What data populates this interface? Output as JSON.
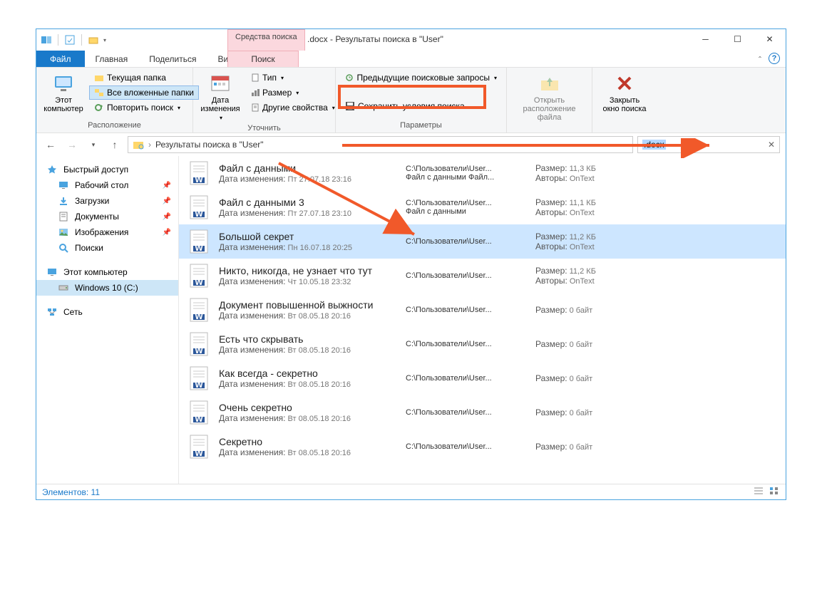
{
  "title": ".docx - Результаты поиска в \"User\"",
  "context_tab": "Средства поиска",
  "tabs": {
    "file": "Файл",
    "main": "Главная",
    "share": "Поделиться",
    "view": "Вид",
    "search": "Поиск"
  },
  "ribbon": {
    "group_location": "Расположение",
    "group_refine": "Уточнить",
    "group_options": "Параметры",
    "this_pc": "Этот компьютер",
    "current_folder": "Текущая папка",
    "all_subfolders": "Все вложенные папки",
    "repeat_search": "Повторить поиск",
    "date_modified": "Дата изменения",
    "type": "Тип",
    "size": "Размер",
    "other_props": "Другие свойства",
    "recent_queries": "Предыдущие поисковые запросы",
    "save_search": "Сохранить условия поиска",
    "open_location": "Открыть расположение файла",
    "close_search": "Закрыть окно поиска"
  },
  "breadcrumb": "Результаты поиска в \"User\"",
  "search_value": ".docx",
  "sidebar": {
    "quick_access": "Быстрый доступ",
    "desktop": "Рабочий стол",
    "downloads": "Загрузки",
    "documents": "Документы",
    "pictures": "Изображения",
    "searches": "Поиски",
    "this_pc": "Этот компьютер",
    "drive": "Windows 10 (C:)",
    "network": "Сеть"
  },
  "labels": {
    "date_modified": "Дата изменения:",
    "size": "Размер:",
    "authors": "Авторы:",
    "items": "Элементов:"
  },
  "item_count": "11",
  "results": [
    {
      "name": "Файл с данными",
      "date": "Пт 27.07.18 23:16",
      "path": "C:\\Пользователи\\User...",
      "path2": "Файл с данными Файл...",
      "size": "11,3 КБ",
      "authors": "OnText"
    },
    {
      "name": "Файл с данными 3",
      "date": "Пт 27.07.18 23:10",
      "path": "C:\\Пользователи\\User...",
      "path2": "Файл с данными",
      "size": "11,1 КБ",
      "authors": "OnText"
    },
    {
      "name": "Большой секрет",
      "date": "Пн 16.07.18 20:25",
      "path": "C:\\Пользователи\\User...",
      "path2": "",
      "size": "11,2 КБ",
      "authors": "OnText"
    },
    {
      "name": "Никто, никогда, не узнает что тут",
      "date": "Чт 10.05.18 23:32",
      "path": "C:\\Пользователи\\User...",
      "path2": "",
      "size": "11,2 КБ",
      "authors": "OnText"
    },
    {
      "name": "Документ повышенной выжности",
      "date": "Вт 08.05.18 20:16",
      "path": "C:\\Пользователи\\User...",
      "path2": "",
      "size": "0 байт",
      "authors": ""
    },
    {
      "name": "Есть что скрывать",
      "date": "Вт 08.05.18 20:16",
      "path": "C:\\Пользователи\\User...",
      "path2": "",
      "size": "0 байт",
      "authors": ""
    },
    {
      "name": "Как всегда - секретно",
      "date": "Вт 08.05.18 20:16",
      "path": "C:\\Пользователи\\User...",
      "path2": "",
      "size": "0 байт",
      "authors": ""
    },
    {
      "name": "Очень секретно",
      "date": "Вт 08.05.18 20:16",
      "path": "C:\\Пользователи\\User...",
      "path2": "",
      "size": "0 байт",
      "authors": ""
    },
    {
      "name": "Секретно",
      "date": "Вт 08.05.18 20:16",
      "path": "C:\\Пользователи\\User...",
      "path2": "",
      "size": "0 байт",
      "authors": ""
    }
  ]
}
